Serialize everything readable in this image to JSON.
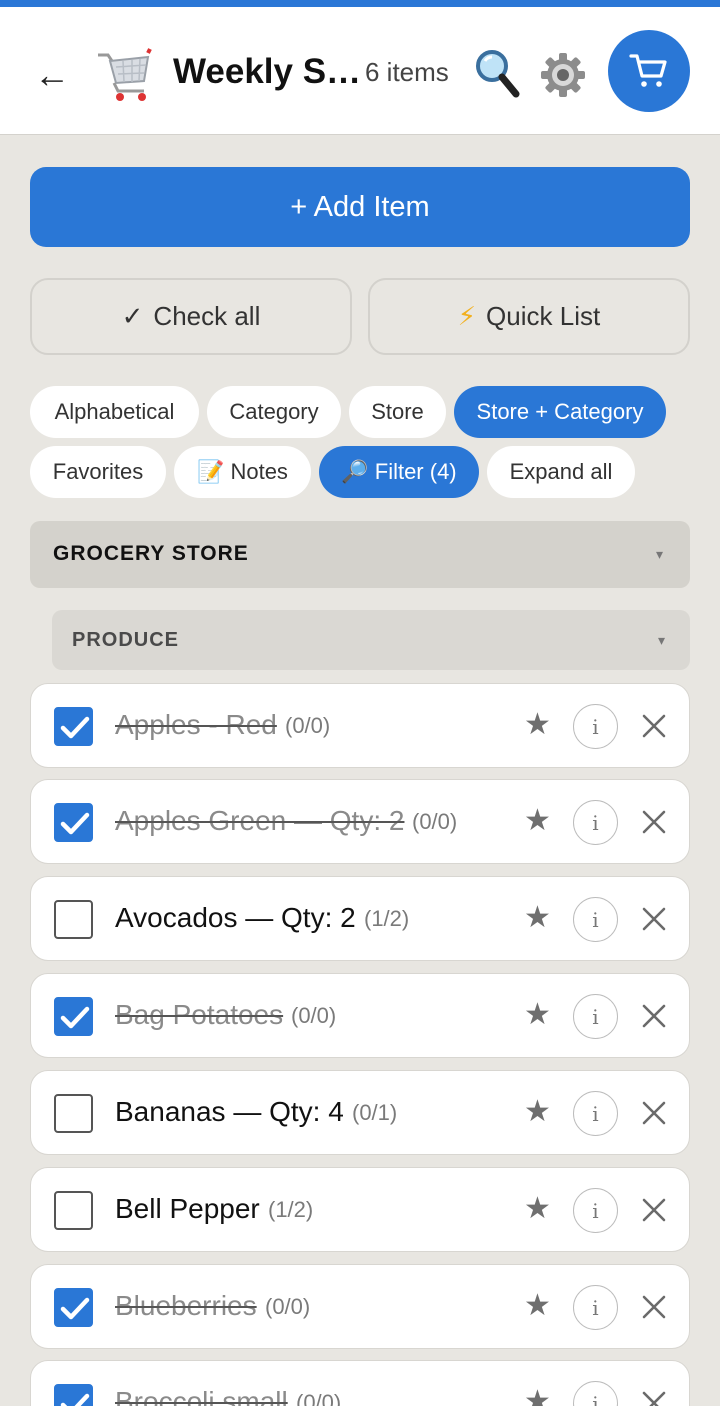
{
  "header": {
    "back_glyph": "←",
    "cart_emoji": "shopping-cart-emoji",
    "title": "Weekly S…",
    "count": "6 items",
    "search_icon": "magnifier-icon",
    "settings_icon": "gear-icon",
    "cart_icon": "cart-icon",
    "accent": "#2a77d6"
  },
  "actions": {
    "add_item": "+ Add Item",
    "check_all_glyph": "✓",
    "check_all": "Check all",
    "quick_list_glyph": "⚡",
    "quick_list": "Quick List"
  },
  "chips": {
    "alphabetical": "Alphabetical",
    "category": "Category",
    "store": "Store",
    "store_category": "Store + Category",
    "favorites": "Favorites",
    "notes_glyph": "📝",
    "notes": "Notes",
    "filter_glyph": "🔎",
    "filter": "Filter (4)",
    "expand_all": "Expand all",
    "active": [
      "Store + Category",
      "Filter (4)"
    ]
  },
  "groups": {
    "store": "GROCERY STORE",
    "category": "PRODUCE",
    "caret": "▾"
  },
  "items": [
    {
      "name": "Apples - Red",
      "progress": "(0/0)",
      "checked": true
    },
    {
      "name": "Apples Green — Qty: 2",
      "progress": "(0/0)",
      "checked": true
    },
    {
      "name": "Avocados — Qty: 2",
      "progress": "(1/2)",
      "checked": false
    },
    {
      "name": "Bag Potatoes",
      "progress": "(0/0)",
      "checked": true
    },
    {
      "name": "Bananas — Qty: 4",
      "progress": "(0/1)",
      "checked": false
    },
    {
      "name": "Bell Pepper",
      "progress": "(1/2)",
      "checked": false
    },
    {
      "name": "Blueberries",
      "progress": "(0/0)",
      "checked": true
    },
    {
      "name": "Broccoli small",
      "progress": "(0/0)",
      "checked": true
    }
  ],
  "item_actions": {
    "star": "★",
    "info": "i"
  }
}
